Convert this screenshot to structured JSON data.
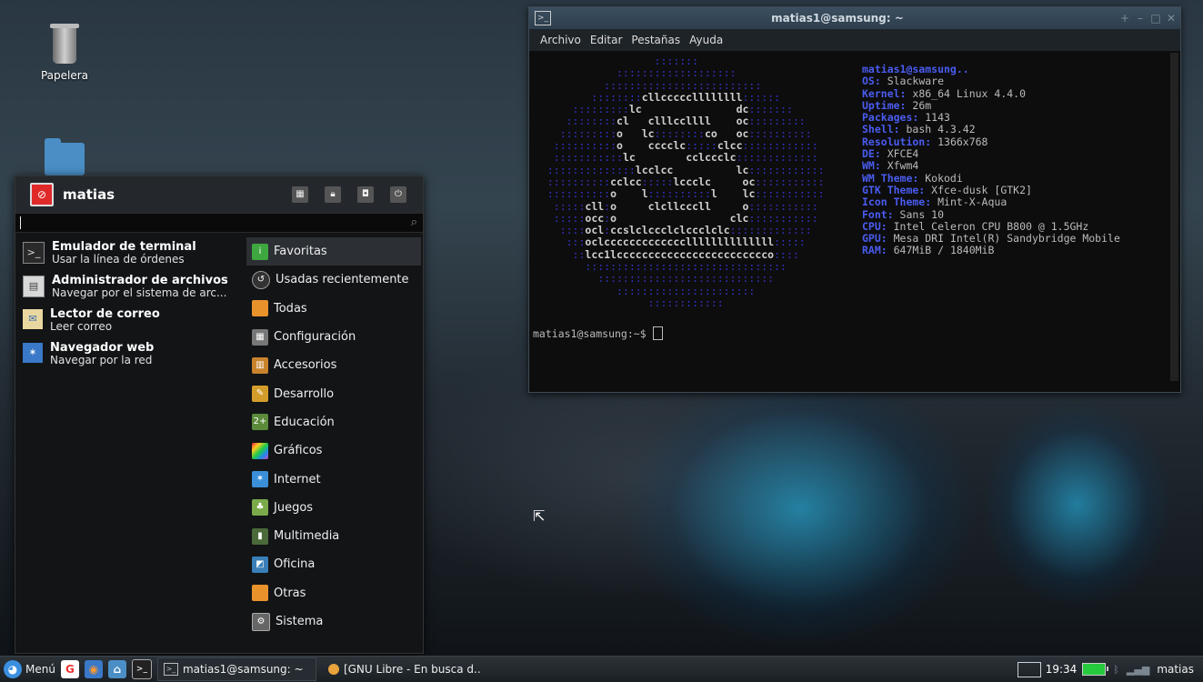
{
  "desktop": {
    "icons": [
      {
        "label": "Papelera",
        "icon": "trash-icon"
      },
      {
        "label": "",
        "icon": "home-folder-icon"
      }
    ]
  },
  "terminal": {
    "title": "matias1@samsung: ~",
    "menu": [
      "Archivo",
      "Editar",
      "Pestañas",
      "Ayuda"
    ],
    "info_title": "matias1@samsung..",
    "info": [
      {
        "key": "OS:",
        "value": " Slackware"
      },
      {
        "key": "Kernel:",
        "value": " x86_64 Linux 4.4.0"
      },
      {
        "key": "Uptime:",
        "value": " 26m"
      },
      {
        "key": "Packages:",
        "value": " 1143"
      },
      {
        "key": "Shell:",
        "value": " bash 4.3.42"
      },
      {
        "key": "Resolution:",
        "value": " 1366x768"
      },
      {
        "key": "DE:",
        "value": " XFCE4"
      },
      {
        "key": "WM:",
        "value": " Xfwm4"
      },
      {
        "key": "WM Theme:",
        "value": " Kokodi"
      },
      {
        "key": "GTK Theme:",
        "value": " Xfce-dusk [GTK2]"
      },
      {
        "key": "Icon Theme:",
        "value": " Mint-X-Aqua"
      },
      {
        "key": "Font:",
        "value": " Sans 10"
      },
      {
        "key": "CPU:",
        "value": " Intel Celeron CPU B800 @ 1.5GHz"
      },
      {
        "key": "GPU:",
        "value": " Mesa DRI Intel(R) Sandybridge Mobile"
      },
      {
        "key": "RAM:",
        "value": " 647MiB / 1840MiB"
      }
    ],
    "prompt": "matias1@samsung:~$ "
  },
  "menu": {
    "user": "matias",
    "search_value": "",
    "apps": [
      {
        "name": "Emulador de terminal",
        "desc": "Usar la línea de órdenes",
        "icon": "terminal-icon"
      },
      {
        "name": "Administrador de archivos",
        "desc": "Navegar por el sistema de arc...",
        "icon": "file-manager-icon"
      },
      {
        "name": "Lector de correo",
        "desc": "Leer correo",
        "icon": "mail-icon"
      },
      {
        "name": "Navegador web",
        "desc": "Navegar por la red",
        "icon": "browser-icon"
      }
    ],
    "categories": [
      {
        "name": "Favoritas",
        "icon": "favorites-icon",
        "color": "#3fa73f"
      },
      {
        "name": "Usadas recientemente",
        "icon": "recent-icon",
        "color": "#333333"
      },
      {
        "name": "Todas",
        "icon": "all-icon",
        "color": "#e8922c"
      },
      {
        "name": "Configuración",
        "icon": "settings-icon",
        "color": "#777777"
      },
      {
        "name": "Accesorios",
        "icon": "accessories-icon",
        "color": "#c8822c"
      },
      {
        "name": "Desarrollo",
        "icon": "development-icon",
        "color": "#d49c2a"
      },
      {
        "name": "Educación",
        "icon": "education-icon",
        "color": "#5a8a3a"
      },
      {
        "name": "Gráficos",
        "icon": "graphics-icon",
        "color": "#c04ab0"
      },
      {
        "name": "Internet",
        "icon": "internet-icon",
        "color": "#3a8fd8"
      },
      {
        "name": "Juegos",
        "icon": "games-icon",
        "color": "#7aaa4a"
      },
      {
        "name": "Multimedia",
        "icon": "multimedia-icon",
        "color": "#4a6a3a"
      },
      {
        "name": "Oficina",
        "icon": "office-icon",
        "color": "#3a7fb8"
      },
      {
        "name": "Otras",
        "icon": "other-icon",
        "color": "#e8922c"
      },
      {
        "name": "Sistema",
        "icon": "system-icon",
        "color": "#666666"
      }
    ]
  },
  "taskbar": {
    "menu_label": "Menú",
    "tasks": [
      {
        "label": "matias1@samsung: ~",
        "icon": "terminal-icon"
      },
      {
        "label": "[GNU Libre - En busca d...",
        "icon": "chromium-icon"
      }
    ],
    "clock": "19:34",
    "user": "matias"
  }
}
